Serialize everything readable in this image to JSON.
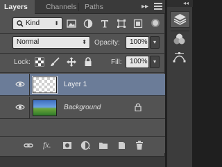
{
  "tabs": [
    {
      "label": "Layers",
      "active": true
    },
    {
      "label": "Channels",
      "active": false
    },
    {
      "label": "Paths",
      "active": false
    }
  ],
  "tab_collapse": "▸▸",
  "filter": {
    "label": "Kind",
    "icons": [
      "image-filter-icon",
      "adjustment-filter-icon",
      "type-filter-icon",
      "shape-filter-icon",
      "smart-object-filter-icon"
    ]
  },
  "blend": {
    "mode": "Normal",
    "opacity_label": "Opacity:",
    "opacity_value": "100%"
  },
  "lock": {
    "label": "Lock:",
    "fill_label": "Fill:",
    "fill_value": "100%"
  },
  "layers": [
    {
      "name": "Layer 1",
      "selected": true,
      "visible": true,
      "thumb": "transparent",
      "locked": false
    },
    {
      "name": "Background",
      "selected": false,
      "visible": true,
      "thumb": "landscape",
      "locked": true
    }
  ],
  "footer": {
    "fx": "fx."
  },
  "colors": {
    "panel": "#535353",
    "selected": "#6b7c98",
    "tabbar": "#3a3a3a",
    "dock": "#3c3c3c"
  }
}
